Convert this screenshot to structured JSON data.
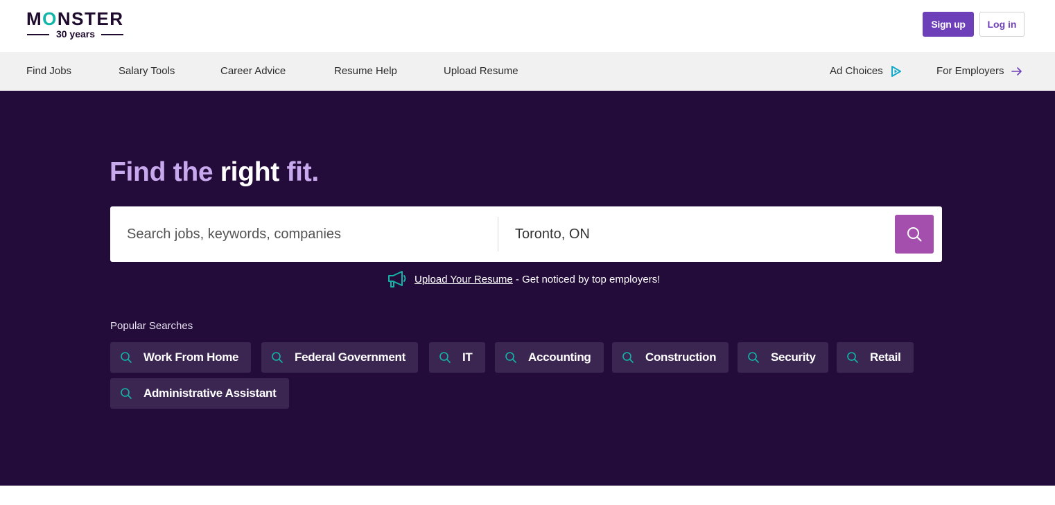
{
  "brand": {
    "logo_word_pre": "M",
    "logo_word_o": "O",
    "logo_word_post": "NSTER",
    "logo_sub": "30 years",
    "accent_purple": "#6d3fb8",
    "hero_bg": "#230b3a",
    "teal": "#12b5a8"
  },
  "header": {
    "signup_label": "Sign up",
    "login_label": "Log in"
  },
  "nav": {
    "items": [
      {
        "label": "Find Jobs"
      },
      {
        "label": "Salary Tools"
      },
      {
        "label": "Career Advice"
      },
      {
        "label": "Resume Help"
      },
      {
        "label": "Upload Resume"
      }
    ],
    "ad_choices": {
      "label": "Ad Choices",
      "icon": "ad-choices-icon"
    },
    "for_employers": {
      "label": "For Employers",
      "icon": "arrow-right-icon"
    }
  },
  "hero": {
    "headline_part1": "Find the ",
    "headline_part2": "right",
    "headline_part3": " fit."
  },
  "search": {
    "keyword_placeholder": "Search jobs, keywords, companies",
    "location_value": "Toronto, ON",
    "button_icon": "search-icon"
  },
  "upload": {
    "icon": "megaphone-icon",
    "link_text": "Upload Your Resume",
    "tail_text": " - Get noticed by top employers!"
  },
  "popular": {
    "label": "Popular Searches",
    "chips": [
      {
        "label": "Work From Home"
      },
      {
        "label": "Federal Government"
      },
      {
        "label": "IT"
      },
      {
        "label": "Accounting"
      },
      {
        "label": "Construction"
      },
      {
        "label": "Security"
      },
      {
        "label": "Retail"
      },
      {
        "label": "Administrative Assistant"
      }
    ]
  }
}
